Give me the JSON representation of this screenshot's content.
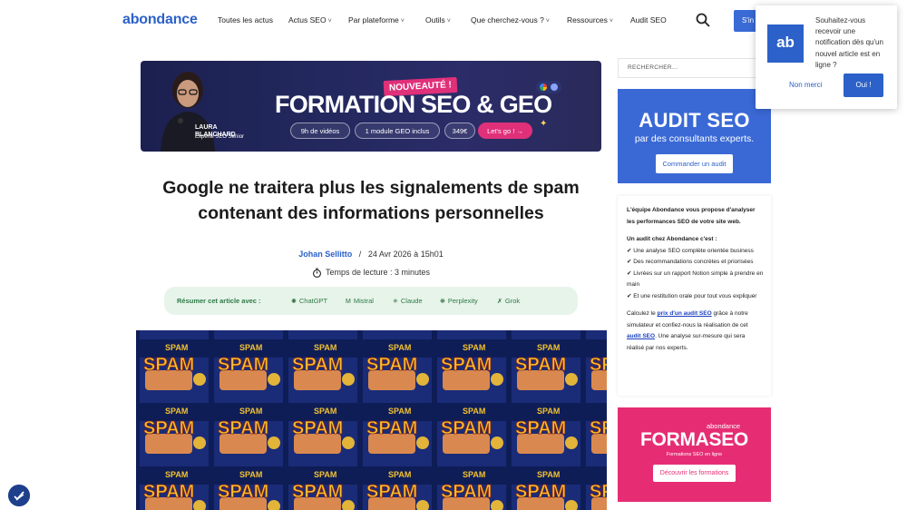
{
  "header": {
    "logo": "abondance",
    "nav": [
      {
        "label": "Toutes les actus",
        "caret": ""
      },
      {
        "label": "Actus SEO",
        "caret": "˅"
      },
      {
        "label": "Par plateforme",
        "caret": "˅"
      },
      {
        "label": "Outils",
        "caret": "˅"
      },
      {
        "label": "Que cherchez-vous ?",
        "caret": "˅"
      },
      {
        "label": "Ressources",
        "caret": "˅"
      },
      {
        "label": "Audit SEO",
        "caret": ""
      }
    ],
    "cta_label": "S'in",
    "icons": {
      "search": "search-icon"
    }
  },
  "banner": {
    "badge": "NOUVEAUTÉ !",
    "title": "FORMATION SEO & GEO",
    "person_name": "LAURA BLANCHARD",
    "person_role": "Experte SEO Senior",
    "pills": [
      "9h de vidéos",
      "1 module GEO inclus",
      "349€",
      "Let's go ! →"
    ],
    "colors": {
      "bg": "#1c2050",
      "accent": "#e0307a"
    }
  },
  "article": {
    "title": "Google ne traitera plus les signalements de spam contenant des informations personnelles",
    "author": "Johan Sellitto",
    "separator": "/",
    "date": "24 Avr 2026 à 15h01",
    "reading_time": "Temps de lecture : 3 minutes",
    "summary": {
      "label": "Résumer cet article avec :",
      "tools": [
        {
          "name": "ChatGPT",
          "icon": "✺"
        },
        {
          "name": "Mistral",
          "icon": "M"
        },
        {
          "name": "Claude",
          "icon": "✳"
        },
        {
          "name": "Perplexity",
          "icon": "❋"
        },
        {
          "name": "Grok",
          "icon": "✗"
        }
      ]
    },
    "hero_can_label": "SPAM"
  },
  "sidebar": {
    "search_placeholder": "RECHERCHER...",
    "audit": {
      "title": "AUDIT SEO",
      "subtitle": "par des consultants experts.",
      "button": "Commander un audit",
      "color": "#3a69d6"
    },
    "info": {
      "intro": "L'équipe Abondance vous propose d'analyser les performances SEO de votre site web.",
      "list_title": "Un audit chez Abondance c'est :",
      "items": [
        "✔ Une analyse SEO complète orientée business",
        "✔ Des recommandations concrètes et priorisées",
        "✔ Livrées sur un rapport Notion simple à prendre en main",
        "✔ Et une restitution orale pour tout vous expliquer"
      ],
      "outro_1": "Calculez le",
      "link_price": "prix d'un audit SEO",
      "outro_2": "grâce à notre simulateur et confiez-nous la réalisation de cet",
      "link_audit": "audit SEO",
      "outro_3": ". Une analyse sur-mesure qui sera réalisé par nos experts."
    },
    "formaseo": {
      "brand": "abondance",
      "title": "FORMASEO",
      "subtitle": "Formations SEO en ligne",
      "button": "Découvrir les formations",
      "color": "#e62d74"
    }
  },
  "notification": {
    "logo": "ab",
    "text": "Souhaitez-vous recevoir une notification dès qu'un nouvel article est en ligne ?",
    "no_label": "Non merci",
    "yes_label": "Oui !"
  }
}
